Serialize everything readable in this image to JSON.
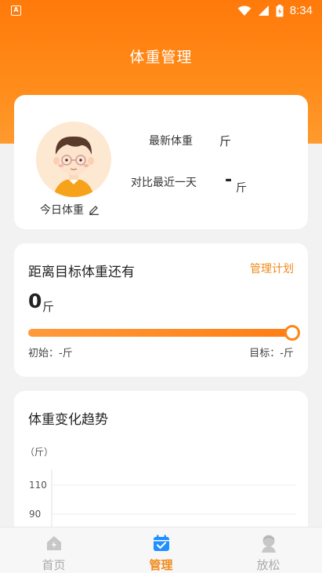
{
  "status_bar": {
    "time": "8:34",
    "app_icon_letter": "A"
  },
  "header": {
    "title": "体重管理"
  },
  "profile": {
    "today_weight_label": "今日体重",
    "latest_weight_label": "最新体重",
    "latest_weight_unit": "斤",
    "compare_label": "对比最近一天",
    "compare_value": "-",
    "compare_unit": "斤"
  },
  "goal": {
    "title": "距离目标体重还有",
    "plan_link": "管理计划",
    "remaining_value": "0",
    "remaining_unit": "斤",
    "progress": 1.0,
    "start_label": "初始：-斤",
    "target_label": "目标：-斤"
  },
  "trend": {
    "title": "体重变化趋势",
    "chart_data": {
      "type": "line",
      "ylabel": "（斤）",
      "y_ticks": [
        "110",
        "90"
      ],
      "series": []
    }
  },
  "tabbar": {
    "tabs": [
      {
        "label": "首页",
        "icon": "home-icon",
        "active": false
      },
      {
        "label": "管理",
        "icon": "calendar-check-icon",
        "active": true
      },
      {
        "label": "放松",
        "icon": "relax-icon",
        "active": false
      }
    ]
  },
  "colors": {
    "accent": "#f08a1c",
    "header": "#ff7a0a"
  }
}
